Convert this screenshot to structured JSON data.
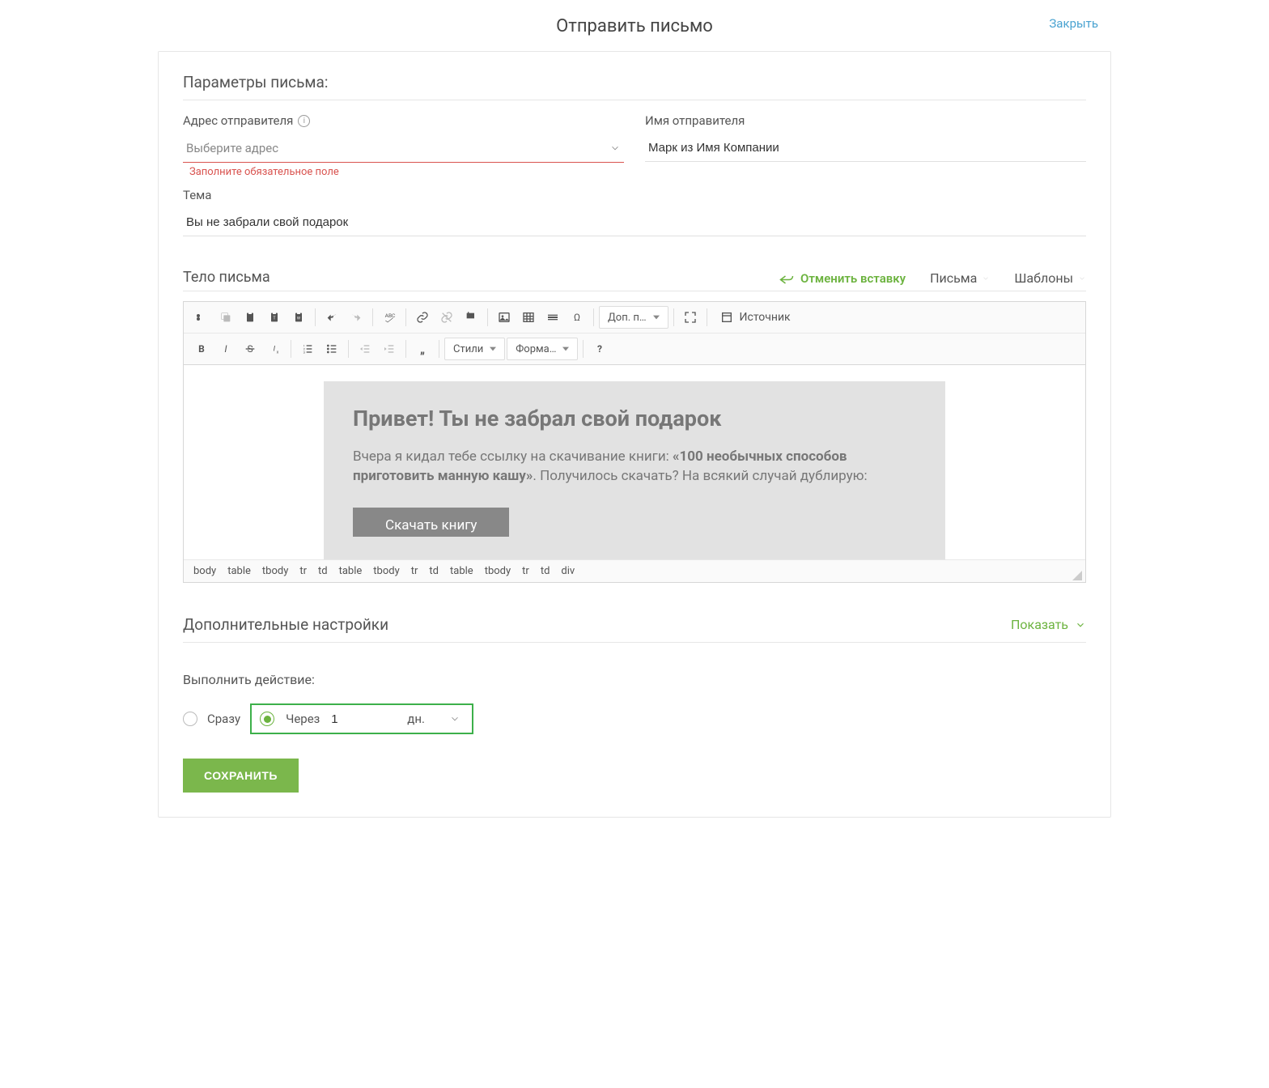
{
  "header": {
    "title": "Отправить письмо",
    "close": "Закрыть"
  },
  "params": {
    "section": "Параметры письма:",
    "sender_addr_label": "Адрес отправителя",
    "sender_addr_placeholder": "Выберите адрес",
    "sender_addr_error": "Заполните обязательное поле",
    "sender_name_label": "Имя отправителя",
    "sender_name_value": "Марк из Имя Компании",
    "subject_label": "Тема",
    "subject_value": "Вы не забрали свой подарок"
  },
  "body": {
    "label": "Тело письма",
    "undo_insert": "Отменить вставку",
    "letters_dd": "Письма",
    "templates_dd": "Шаблоны",
    "toolbar": {
      "more": "Доп. п…",
      "source": "Источник",
      "styles": "Стили",
      "format": "Форма…"
    },
    "content": {
      "heading": "Привет! Ты не забрал свой подарок",
      "p1a": "Вчера я кидал тебе ссылку на скачивание книги: ",
      "p1b": "«100 необычных способов приготовить манную кашу»",
      "p1c": ". Получилось скачать? На всякий случай дублирую:",
      "cta": "Скачать книгу"
    },
    "path": [
      "body",
      "table",
      "tbody",
      "tr",
      "td",
      "table",
      "tbody",
      "tr",
      "td",
      "table",
      "tbody",
      "tr",
      "td",
      "div"
    ]
  },
  "extra": {
    "title": "Дополнительные настройки",
    "show": "Показать"
  },
  "action": {
    "label": "Выполнить действие:",
    "now": "Сразу",
    "after": "Через",
    "value": "1",
    "unit": "дн."
  },
  "save": "СОХРАНИТЬ"
}
